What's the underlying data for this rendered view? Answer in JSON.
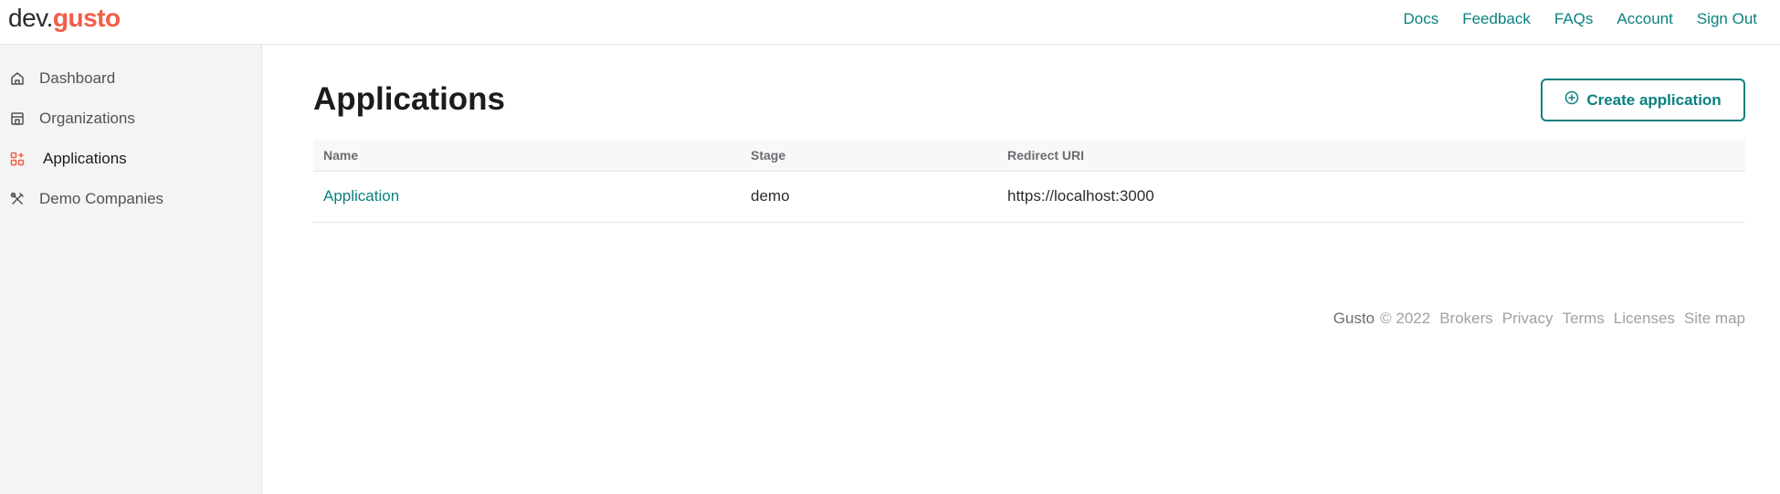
{
  "logo": {
    "prefix": "dev",
    "dot": ".",
    "brand": "gusto"
  },
  "topnav": [
    "Docs",
    "Feedback",
    "FAQs",
    "Account",
    "Sign Out"
  ],
  "sidebar": {
    "items": [
      {
        "label": "Dashboard",
        "icon": "home-icon"
      },
      {
        "label": "Organizations",
        "icon": "building-icon"
      },
      {
        "label": "Applications",
        "icon": "apps-grid-icon",
        "active": true
      },
      {
        "label": "Demo Companies",
        "icon": "tools-icon"
      }
    ]
  },
  "main": {
    "title": "Applications",
    "create_button": "Create application"
  },
  "table": {
    "headers": [
      "Name",
      "Stage",
      "Redirect URI"
    ],
    "rows": [
      {
        "name": "Application",
        "stage": "demo",
        "redirect_uri": "https://localhost:3000"
      }
    ]
  },
  "footer": {
    "brand": "Gusto",
    "copyright": "© 2022",
    "links": [
      "Brokers",
      "Privacy",
      "Terms",
      "Licenses",
      "Site map"
    ]
  },
  "colors": {
    "accent": "#0a8080",
    "brand": "#f45d48",
    "sidebar_bg": "#f4f4f3"
  }
}
